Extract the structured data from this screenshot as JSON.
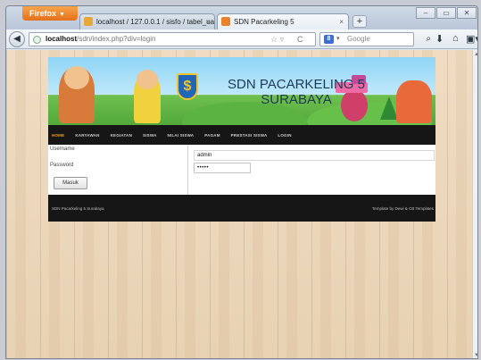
{
  "browser": {
    "app_button": "Firefox",
    "tabs": [
      {
        "title": "localhost / 127.0.0.1 / sisfo / tabel_ua...",
        "close": "×"
      },
      {
        "title": "SDN Pacarkeling 5",
        "close": "×"
      }
    ],
    "new_tab": "+",
    "window_controls": {
      "minimize": "–",
      "maximize": "▭",
      "close": "✕"
    },
    "back": "◀",
    "url_host": "localhost",
    "url_path": "/sdn/index.php?div=login",
    "url_star": "☆ ▿",
    "url_reload": "C",
    "search_engine": "8",
    "search_caret": "▾",
    "search_placeholder": "Google",
    "search_icon": "⌕",
    "nav_icons": {
      "download": "⬇",
      "home": "⌂",
      "menu": "▣▾"
    },
    "scroll_up": "▲",
    "scroll_down": "▼"
  },
  "banner": {
    "emblem": "$",
    "title_line1": "SDN PACARKELING 5",
    "title_line2": "SURABAYA"
  },
  "menu": [
    {
      "label": "HOME",
      "active": true
    },
    {
      "label": "KARYAWAN",
      "active": false
    },
    {
      "label": "KEGIATAN",
      "active": false
    },
    {
      "label": "SISWA",
      "active": false
    },
    {
      "label": "NILAI SISWA",
      "active": false
    },
    {
      "label": "PAGAM",
      "active": false
    },
    {
      "label": "PRESTASI SISWA",
      "active": false
    },
    {
      "label": "LOGIN",
      "active": false
    }
  ],
  "login": {
    "username_label": "Username",
    "password_label": "Password",
    "username_value": "admin",
    "password_value": "•••••",
    "submit_label": "Masuk"
  },
  "footer": {
    "left": "SDN Pacarkeling 5 Surabaya",
    "right": "Template by Dewi & CB Templates"
  },
  "colors": {
    "menu_bg": "#161616",
    "menu_active": "#f0a028",
    "firefox_button": "#e4701c",
    "page_background": "#e8d2b3"
  }
}
